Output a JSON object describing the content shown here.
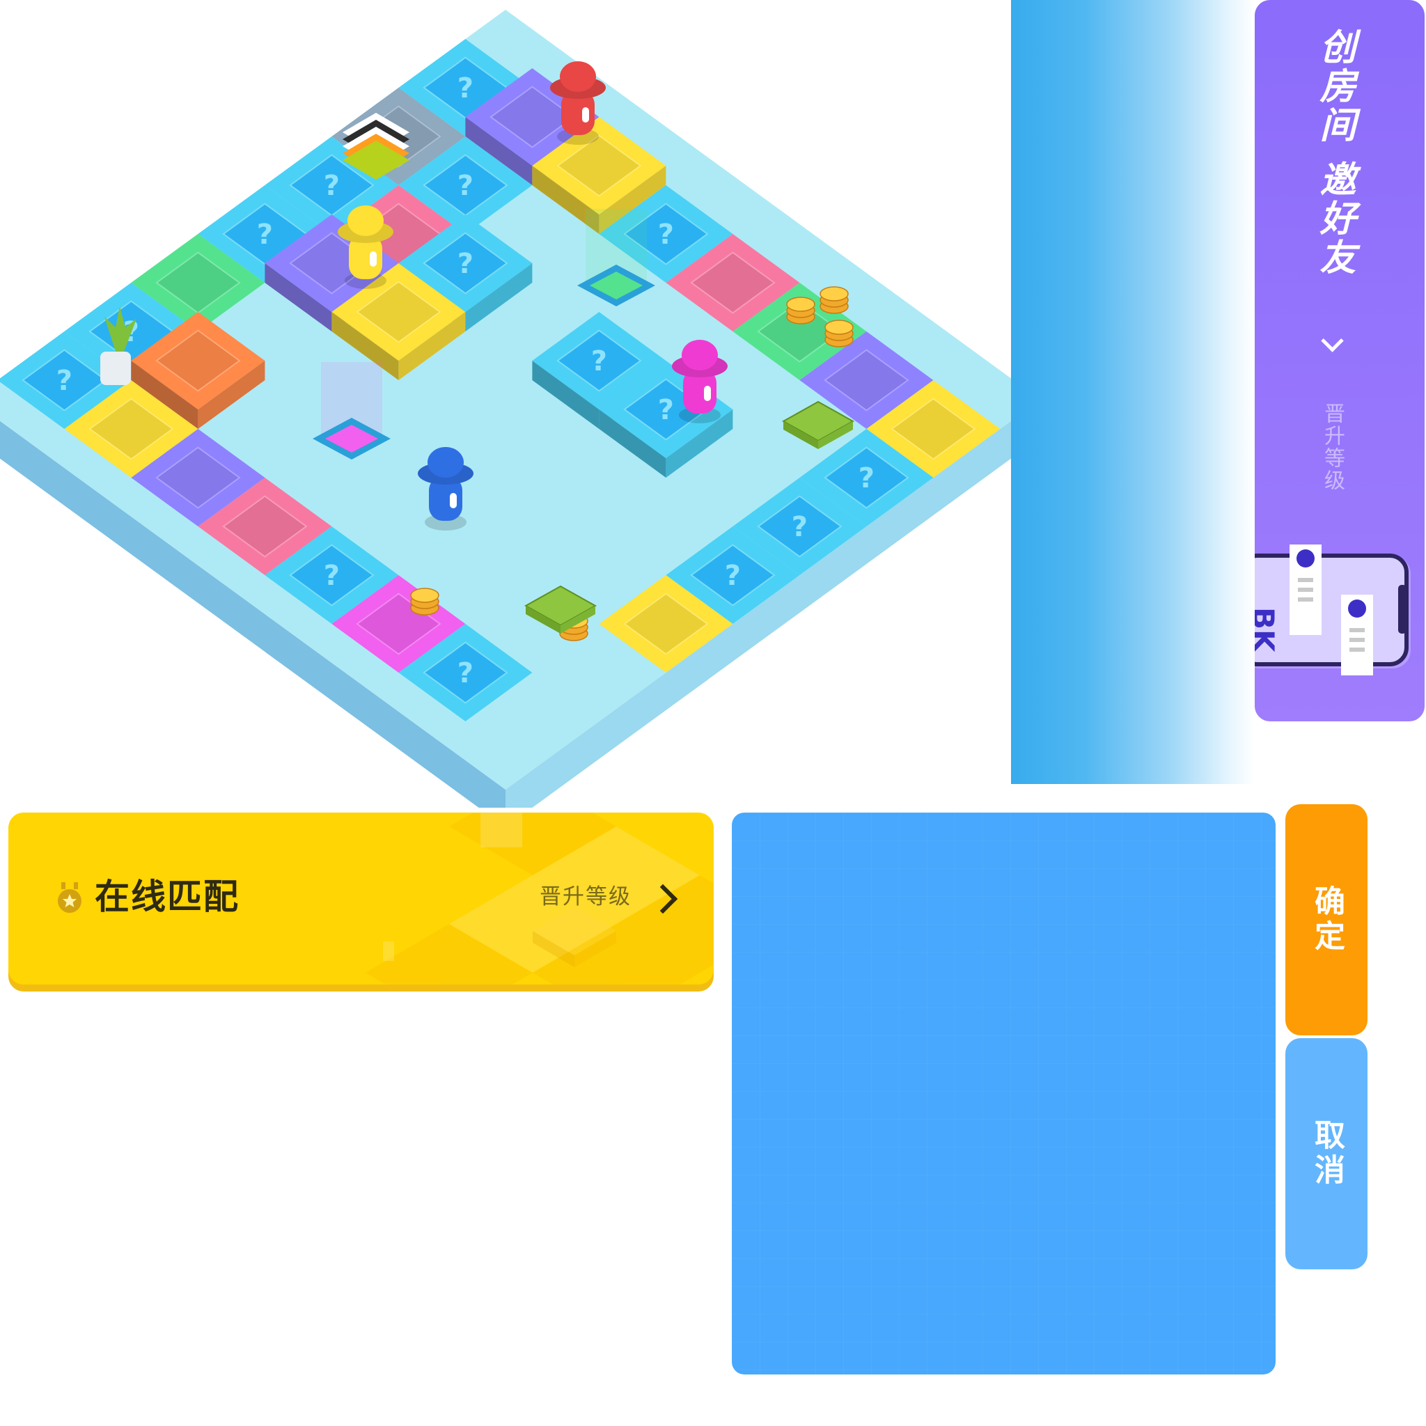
{
  "board": {
    "colors": {
      "platform_top": "#aeeaf5",
      "platform_left": "#7bbfe3",
      "platform_right": "#9ad9ef",
      "question_tile": "#4bd1f5",
      "question_tile_inner": "#2ab1f2",
      "pink": "#f779a2",
      "yellow": "#ffe23a",
      "green": "#54e28f",
      "purple": "#8f82ff",
      "orange": "#ff8a4a",
      "magenta": "#f160ee",
      "gray": "#8fa9bf"
    },
    "pieces": [
      {
        "name": "red-player-piece",
        "color": "#e94646"
      },
      {
        "name": "yellow-player-piece",
        "color": "#ffe034"
      },
      {
        "name": "pink-player-piece",
        "color": "#f03bd2"
      },
      {
        "name": "blue-player-piece",
        "color": "#2f6fe4"
      }
    ]
  },
  "create_room": {
    "title": "创房间 邀好友",
    "subtitle": "晋升等级",
    "icons": {
      "chevron": "chevron-right-icon"
    }
  },
  "online_match": {
    "label": "在线匹配",
    "subtitle": "晋升等级",
    "icons": {
      "medal": "medal-icon",
      "chevron": "chevron-right-icon"
    }
  },
  "buttons": {
    "confirm": "确定",
    "cancel": "取消"
  },
  "colors": {
    "create_room_bg": "#8b6cfb",
    "online_match_bg": "#ffd503",
    "blue_panel_bg": "#47a8fd",
    "confirm_bg": "#fd9c05",
    "cancel_bg": "#63b6fd"
  }
}
